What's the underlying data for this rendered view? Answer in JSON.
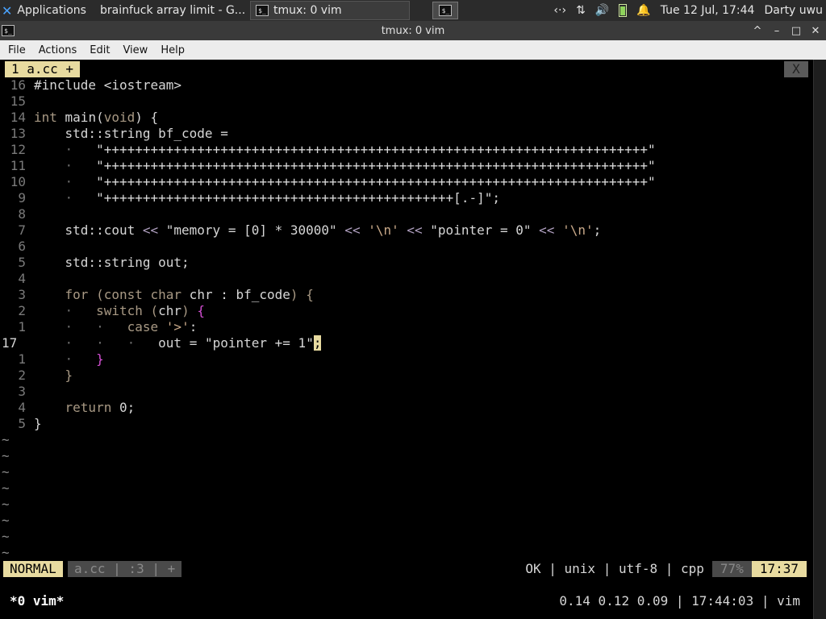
{
  "panel": {
    "applications_label": "Applications",
    "win1_title": "brainfuck array limit - G...",
    "win2_title": "tmux: 0 vim",
    "clock": "Tue 12 Jul, 17:44",
    "user": "Darty uwu"
  },
  "window": {
    "title": "tmux: 0 vim",
    "minimize": "^",
    "shade": "–",
    "maximize": "□",
    "close": "✕"
  },
  "menubar": {
    "items": [
      "File",
      "Actions",
      "Edit",
      "View",
      "Help"
    ]
  },
  "vim": {
    "tab_label": "1  a.cc +",
    "tab_close": "X",
    "line_numbers": [
      "16",
      "15",
      "14",
      "13",
      "12",
      "11",
      "10",
      "9",
      "8",
      "7",
      "6",
      "5",
      "4",
      "3",
      "2",
      "1",
      "17",
      "1",
      "2",
      "3",
      "4",
      "5"
    ],
    "status": {
      "mode": "NORMAL",
      "file": "a.cc  |  :3  |  +",
      "info": "OK  |  unix  |  utf-8  |  cpp",
      "percent": "77%",
      "position": "17:37"
    }
  },
  "tmux": {
    "window": "*0 vim*",
    "right": "0.14 0.12 0.09  |  17:44:03  |  vim"
  },
  "colors": {
    "accent": "#e8dba0",
    "background": "#000000",
    "magenta": "#d34fd3"
  }
}
